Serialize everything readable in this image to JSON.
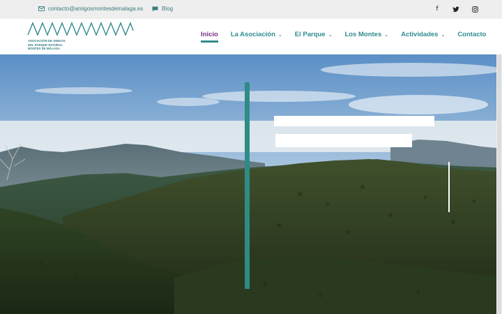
{
  "topbar": {
    "email": "contacto@amigosmontesdemalaga.es",
    "blog_label": "Blog",
    "socials": [
      {
        "name": "facebook",
        "glyph": "f"
      },
      {
        "name": "twitter",
        "glyph": "🐦"
      },
      {
        "name": "instagram",
        "glyph": "◎"
      }
    ]
  },
  "logo": {
    "lines": [
      "ASOCIACIÓN DE AMIGOS",
      "DEL PARQUE NATURAL",
      "MONTES DE MÁLAGA"
    ]
  },
  "nav": {
    "items": [
      {
        "label": "Inicio",
        "active": true,
        "has_dropdown": false
      },
      {
        "label": "La Asociación",
        "active": false,
        "has_dropdown": true
      },
      {
        "label": "El Parque",
        "active": false,
        "has_dropdown": true
      },
      {
        "label": "Los Montes",
        "active": false,
        "has_dropdown": true
      },
      {
        "label": "Actividades",
        "active": false,
        "has_dropdown": true
      },
      {
        "label": "Contacto",
        "active": false,
        "has_dropdown": false
      }
    ]
  },
  "colors": {
    "accent": "#2f8b8f",
    "active": "#7a2f8a"
  }
}
